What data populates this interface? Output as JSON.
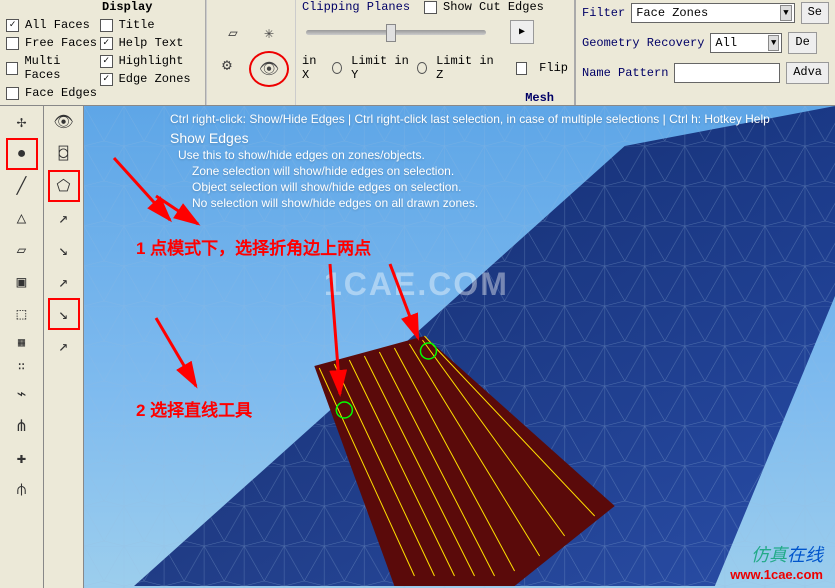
{
  "display": {
    "heading": "Display",
    "left": [
      {
        "label": "All Faces",
        "checked": true
      },
      {
        "label": "Free Faces",
        "checked": false
      },
      {
        "label": "Multi Faces",
        "checked": false
      },
      {
        "label": "Face Edges",
        "checked": false
      }
    ],
    "right": [
      {
        "label": "Title",
        "checked": false
      },
      {
        "label": "Help Text",
        "checked": true
      },
      {
        "label": "Highlight",
        "checked": true
      },
      {
        "label": "Edge Zones",
        "checked": true
      }
    ]
  },
  "toolbar_icons": {
    "box": "▱",
    "burst": "✳",
    "gear": "⚙",
    "eye": "👁"
  },
  "clipping": {
    "label": "Clipping Planes",
    "show_cut_edges": "Show Cut Edges",
    "limit_x": "in X",
    "limit_y": "Limit in Y",
    "limit_z": "Limit in Z",
    "flip": "Flip"
  },
  "filter_group": {
    "filter_label": "Filter",
    "filter_value": "Face Zones",
    "geom_label": "Geometry Recovery",
    "geom_value": "All",
    "name_label": "Name Pattern",
    "name_value": ""
  },
  "buttons": {
    "se": "Se",
    "de": "De",
    "adv": "Adva"
  },
  "mesh_label": "Mesh",
  "left_toolbar": [
    {
      "icon": "axes",
      "name": "axes-icon"
    },
    {
      "icon": "circle",
      "name": "point-mode-icon",
      "boxed": true
    },
    {
      "icon": "pencil",
      "name": "line-icon"
    },
    {
      "icon": "triangle",
      "name": "triangle-icon"
    },
    {
      "icon": "quad",
      "name": "quad-icon"
    },
    {
      "icon": "cube",
      "name": "cube-icon"
    },
    {
      "icon": "multi",
      "name": "multi-icon"
    },
    {
      "icon": "grid",
      "name": "grid-icon"
    },
    {
      "icon": "dots",
      "name": "dots-icon"
    },
    {
      "icon": "curve",
      "name": "curve-icon"
    },
    {
      "icon": "nodes",
      "name": "nodes-icon"
    },
    {
      "icon": "cross",
      "name": "cross-icon"
    },
    {
      "icon": "branch",
      "name": "branch-icon"
    }
  ],
  "right_toolbar": [
    {
      "icon": "eye",
      "name": "eye-icon"
    },
    {
      "icon": "cylinder",
      "name": "body-icon"
    },
    {
      "icon": "poly",
      "name": "poly-select-icon",
      "boxed": true
    },
    {
      "icon": "axis",
      "name": "axis-icon"
    },
    {
      "icon": "snap",
      "name": "snap-icon"
    },
    {
      "icon": "axis2",
      "name": "axis2-icon"
    },
    {
      "icon": "line2pt",
      "name": "line-tool-icon",
      "boxed": true
    },
    {
      "icon": "axis3",
      "name": "axis3-icon"
    }
  ],
  "help": {
    "top": "Ctrl right-click: Show/Hide Edges | Ctrl right-click last selection, in case of multiple selections | Ctrl h: Hotkey Help",
    "title": "Show Edges",
    "l1": "Use this to show/hide edges on zones/objects.",
    "l2": "Zone selection will show/hide edges on selection.",
    "l3": "Object selection will show/hide edges on selection.",
    "l4": "No selection will show/hide edges on all drawn zones."
  },
  "watermark": "1CAE.COM",
  "annot1": "1 点模式下，选择折角边上两点",
  "annot2": "2 选择直线工具",
  "corner": {
    "zh1": "仿真",
    "zh2": "在线",
    "url": "www.1cae.com"
  }
}
